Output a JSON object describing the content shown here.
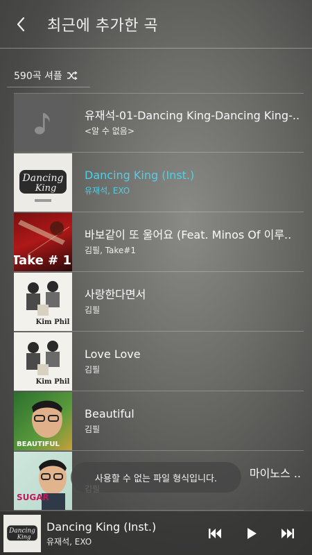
{
  "header": {
    "title": "최근에 추가한 곡",
    "back_icon": "chevron-left-icon"
  },
  "shuffle": {
    "label": "590곡 셔플",
    "icon": "shuffle-icon"
  },
  "songs": [
    {
      "title": "유재석-01-Dancing King-Dancing King-..",
      "artist": "<알 수 없음>",
      "art": "music-note-placeholder",
      "active": false
    },
    {
      "title": "Dancing King (Inst.)",
      "artist": "유재석, EXO",
      "art": "dancing-king-cover",
      "active": true
    },
    {
      "title": "바보같이 또 울어요 (Feat. Minos Of 이루..",
      "artist": "김필, Take#1",
      "art": "take1-cover",
      "active": false,
      "art_text": "Take # 1"
    },
    {
      "title": "사랑한다면서",
      "artist": "김필",
      "art": "kim-phil-cover",
      "active": false,
      "art_text": "Kim Phil"
    },
    {
      "title": "Love Love",
      "artist": "김필",
      "art": "kim-phil-cover",
      "active": false,
      "art_text": "Kim Phil"
    },
    {
      "title": "Beautiful",
      "artist": "김필",
      "art": "kim-feel-beautiful-cover",
      "active": false,
      "art_text": "BEAUTIFUL"
    },
    {
      "title": "마이노스 ..",
      "artist": "김필",
      "art": "kim-feel-sugar-cover",
      "active": false,
      "art_text": "SUGAR"
    }
  ],
  "toast": {
    "message": "사용할 수 없는 파일 형식입니다."
  },
  "mini_player": {
    "title": "Dancing King (Inst.)",
    "artist": "유재석, EXO",
    "controls": [
      "previous-icon",
      "play-icon",
      "next-icon"
    ]
  },
  "colors": {
    "accent": "#4fd0e8",
    "text": "#fafafa"
  }
}
